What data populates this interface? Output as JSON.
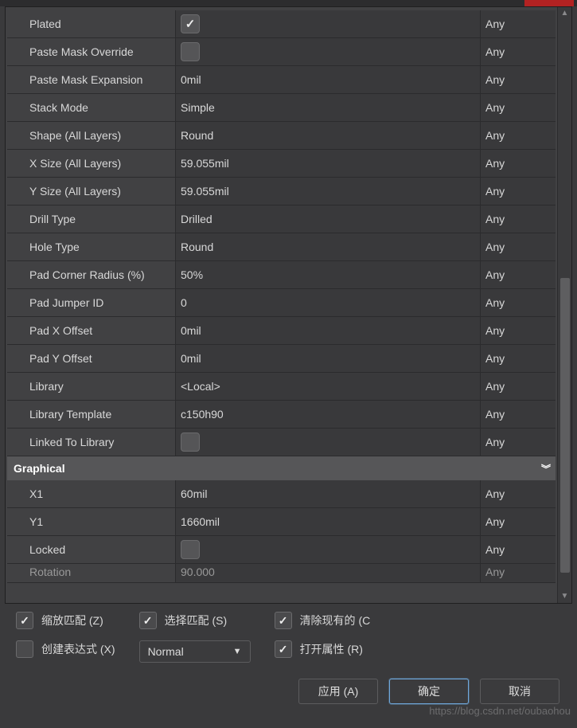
{
  "rows": [
    {
      "label": "Plated",
      "value_kind": "check",
      "checked": true,
      "constraint": "Any"
    },
    {
      "label": "Paste Mask Override",
      "value_kind": "check",
      "checked": false,
      "constraint": "Any"
    },
    {
      "label": "Paste Mask Expansion",
      "value": "0mil",
      "constraint": "Any"
    },
    {
      "label": "Stack Mode",
      "value": "Simple",
      "constraint": "Any"
    },
    {
      "label": "Shape (All Layers)",
      "value": "Round",
      "constraint": "Any"
    },
    {
      "label": "X Size (All Layers)",
      "value": "59.055mil",
      "constraint": "Any"
    },
    {
      "label": "Y Size (All Layers)",
      "value": "59.055mil",
      "constraint": "Any"
    },
    {
      "label": "Drill Type",
      "value": "Drilled",
      "constraint": "Any"
    },
    {
      "label": "Hole Type",
      "value": "Round",
      "constraint": "Any"
    },
    {
      "label": "Pad Corner Radius (%)",
      "value": "50%",
      "constraint": "Any"
    },
    {
      "label": "Pad Jumper ID",
      "value": "0",
      "constraint": "Any"
    },
    {
      "label": "Pad X Offset",
      "value": "0mil",
      "constraint": "Any"
    },
    {
      "label": "Pad Y Offset",
      "value": "0mil",
      "constraint": "Any"
    },
    {
      "label": "Library",
      "value": "<Local>",
      "constraint": "Any"
    },
    {
      "label": "Library Template",
      "value": "c150h90",
      "constraint": "Any"
    },
    {
      "label": "Linked To Library",
      "value_kind": "check",
      "checked": false,
      "constraint": "Any"
    }
  ],
  "section": {
    "title": "Graphical"
  },
  "graphical_rows": [
    {
      "label": "X1",
      "value": "60mil",
      "constraint": "Any"
    },
    {
      "label": "Y1",
      "value": "1660mil",
      "constraint": "Any"
    },
    {
      "label": "Locked",
      "value_kind": "check",
      "checked": false,
      "constraint": "Any"
    },
    {
      "label": "Rotation",
      "value": "90.000",
      "constraint": "Any",
      "cut": true
    }
  ],
  "options": {
    "zoom_match": {
      "label": "缩放匹配 (Z)",
      "checked": true
    },
    "create_expr": {
      "label": "创建表达式 (X)",
      "checked": false
    },
    "select_match": {
      "label": "选择匹配 (S)",
      "checked": true
    },
    "mode_dropdown": "Normal",
    "clear_existing": {
      "label": "清除现有的 (C",
      "checked": true
    },
    "open_props": {
      "label": "打开属性 (R)",
      "checked": true
    }
  },
  "buttons": {
    "apply": "应用 (A)",
    "ok": "确定",
    "cancel": "取消"
  },
  "watermark": "https://blog.csdn.net/oubaohou"
}
